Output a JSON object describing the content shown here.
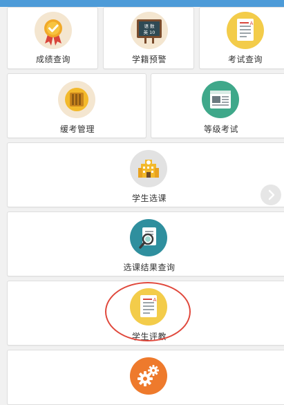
{
  "colors": {
    "top_bar": "#4d9bd8",
    "highlight_ring": "#e0483c",
    "icon_bg_cream": "#f4e6d0",
    "icon_bg_yellow": "#f3cc4a",
    "icon_bg_green": "#3fa88a",
    "icon_bg_teal": "#2f8f9e",
    "icon_bg_orange": "#ee7a2c",
    "icon_bg_gray": "#e2e2e2"
  },
  "tiles": [
    {
      "label": "成绩查询",
      "icon": "award-badge-icon"
    },
    {
      "label": "学籍预警",
      "icon": "chalkboard-icon",
      "board_text": [
        "语 数",
        "英 10"
      ]
    },
    {
      "label": "考试查询",
      "icon": "exam-paper-icon"
    },
    {
      "label": "缓考管理",
      "icon": "notebook-icon"
    },
    {
      "label": "等级考试",
      "icon": "newspaper-icon"
    },
    {
      "label": "学生选课",
      "icon": "school-building-icon"
    },
    {
      "label": "选课结果查询",
      "icon": "magnifier-icon"
    },
    {
      "label": "学生评教",
      "icon": "evaluation-paper-icon"
    },
    {
      "label": "",
      "icon": "gears-icon"
    }
  ],
  "carousel_arrow": {
    "icon": "chevron-right-icon"
  }
}
